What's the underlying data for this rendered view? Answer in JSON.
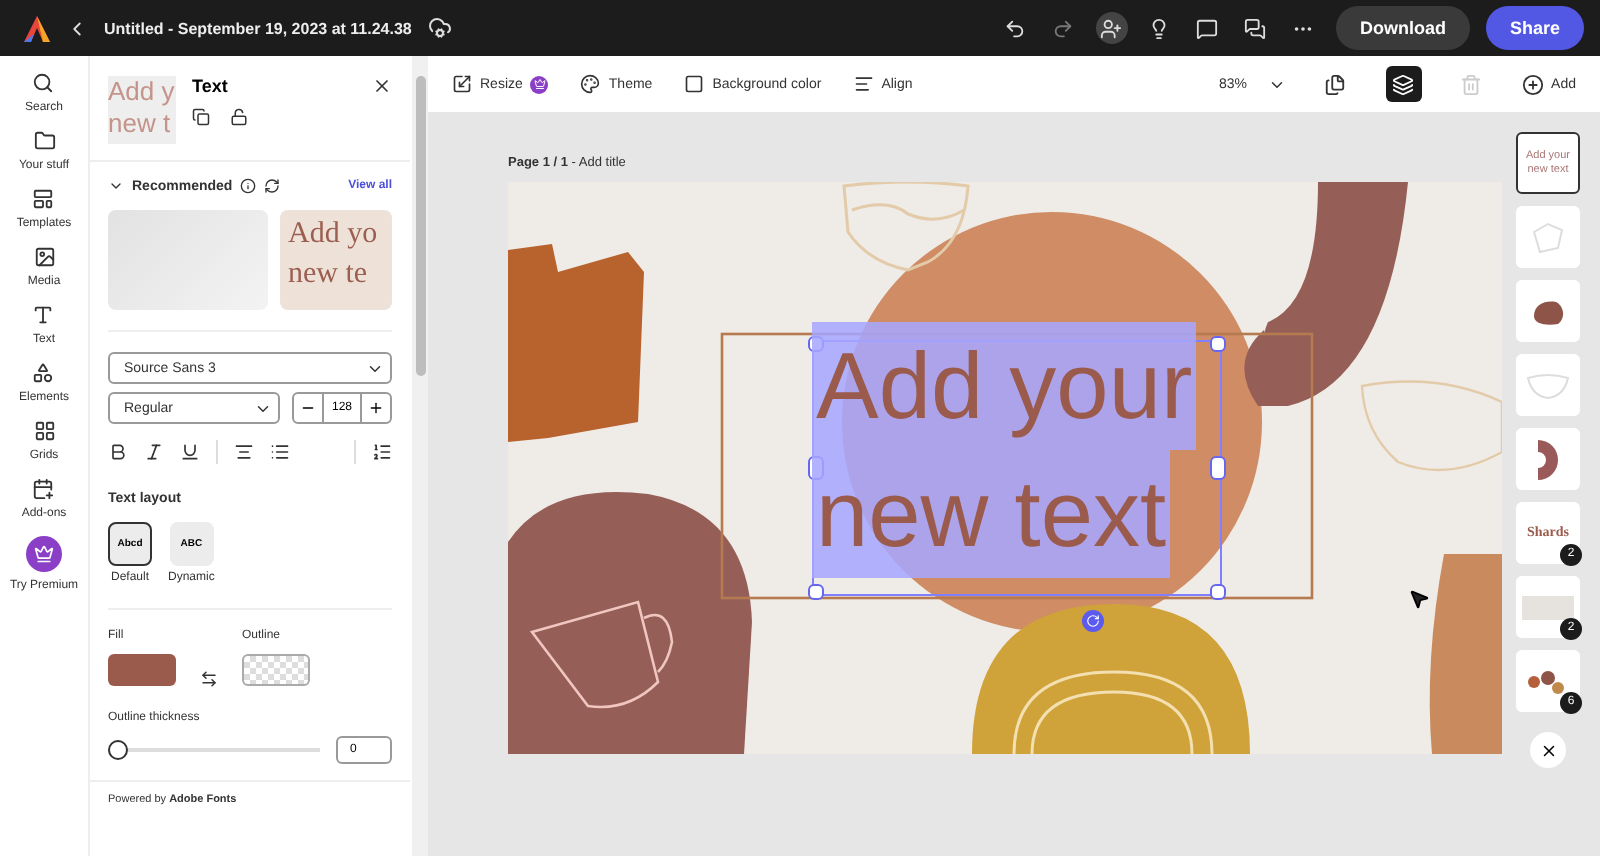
{
  "topbar": {
    "title": "Untitled - September 19, 2023 at 11.24.38",
    "actions": [
      {
        "kind": "undo",
        "disabled": false
      },
      {
        "kind": "redo",
        "disabled": true
      },
      {
        "kind": "invite",
        "disabled": false
      },
      {
        "kind": "bulb",
        "disabled": false
      },
      {
        "kind": "comment",
        "disabled": false
      },
      {
        "kind": "chat",
        "disabled": false
      },
      {
        "kind": "more",
        "disabled": false
      }
    ],
    "download": "Download",
    "share": "Share"
  },
  "rail": {
    "items": [
      {
        "kind": "search",
        "label": "Search"
      },
      {
        "kind": "folder",
        "label": "Your stuff"
      },
      {
        "kind": "templates",
        "label": "Templates"
      },
      {
        "kind": "media",
        "label": "Media"
      },
      {
        "kind": "text",
        "label": "Text"
      },
      {
        "kind": "elements",
        "label": "Elements"
      },
      {
        "kind": "grids",
        "label": "Grids"
      },
      {
        "kind": "addons",
        "label": "Add-ons"
      },
      {
        "kind": "premium",
        "label": "Try Premium"
      }
    ]
  },
  "panel": {
    "preview": [
      "Add y",
      "new t"
    ],
    "title": "Text",
    "recommended": {
      "title": "Recommended",
      "view_all": "View all",
      "cards": [
        {
          "kind": "blank"
        },
        {
          "kind": "text",
          "lines": [
            "Add yo",
            "new te"
          ]
        }
      ]
    },
    "font": {
      "family": "Source Sans 3",
      "style": "Regular",
      "size": "128"
    },
    "text_layout": {
      "title": "Text layout",
      "options": [
        {
          "label": "Default",
          "sample": "Abcd",
          "selected": true
        },
        {
          "label": "Dynamic",
          "sample": "ABC",
          "selected": false
        }
      ]
    },
    "fill": {
      "label": "Fill"
    },
    "outline": {
      "label": "Outline"
    },
    "thickness": {
      "label": "Outline thickness",
      "level": 0,
      "value": "0"
    },
    "footer": "Powered by **Adobe Fonts**"
  },
  "toolbar": {
    "tools": [
      {
        "kind": "resize",
        "label": "Resize",
        "premium": true
      },
      {
        "kind": "theme",
        "label": "Theme",
        "premium": false
      },
      {
        "kind": "background",
        "label": "Background color",
        "premium": false
      },
      {
        "kind": "align",
        "label": "Align",
        "premium": false
      }
    ],
    "zoom": "83%",
    "right_tools": [
      {
        "kind": "pages",
        "selected": false,
        "disabled": false
      },
      {
        "kind": "layers",
        "selected": true,
        "disabled": false
      },
      {
        "kind": "delete",
        "selected": false,
        "disabled": true
      }
    ],
    "add": "Add"
  },
  "canvas": {
    "page_label": "**Page 1 / 1** - Add title",
    "text_lines": [
      "Add your",
      "new text"
    ],
    "thumbnails": [
      {
        "kind": "text",
        "lines": [
          "Add your",
          "new text"
        ],
        "selected": true
      },
      {
        "kind": "outline",
        "selected": false
      },
      {
        "kind": "blob",
        "selected": false
      },
      {
        "kind": "bowl",
        "selected": false
      },
      {
        "kind": "arc",
        "selected": false
      },
      {
        "kind": "title",
        "title": "Shards",
        "count": "2",
        "selected": false
      },
      {
        "kind": "block",
        "count": "2",
        "selected": false
      },
      {
        "kind": "shapes",
        "count": "6",
        "selected": false
      }
    ]
  }
}
